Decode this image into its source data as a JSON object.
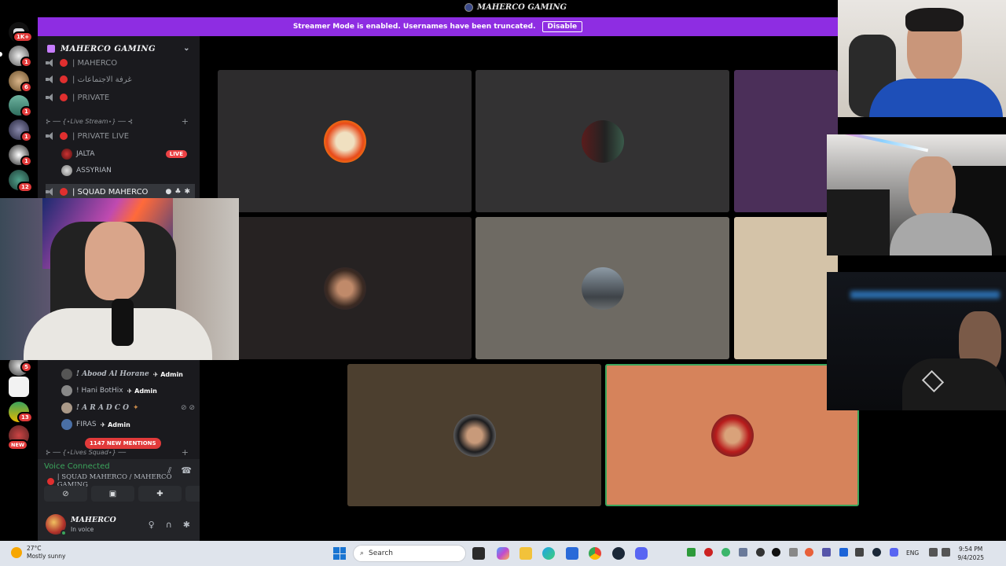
{
  "window": {
    "title": "MAHERCO GAMING"
  },
  "banner": {
    "text": "Streamer Mode is enabled. Usernames have been truncated.",
    "button": "Disable"
  },
  "rail": {
    "top_badge": "1K+",
    "badges": [
      "1",
      "6",
      "1",
      "1",
      "1",
      "12",
      "5",
      "13",
      "NEW"
    ]
  },
  "guild": {
    "name": "MAHERCO GAMING"
  },
  "channels": [
    {
      "label": "| MAHERCO"
    },
    {
      "label": "| غرفة الاجتماعات"
    },
    {
      "label": "| PRIVATE"
    }
  ],
  "category_live": "⊱ ── {⋆Live Stream⋆} ── ⊰",
  "channel_private_live": "| PRIVATE LIVE",
  "live_members": [
    {
      "name": "JALTA",
      "badge": "LIVE"
    },
    {
      "name": "ASSYRIAN"
    }
  ],
  "active_channel": "| SQUAD MAHERCO",
  "squad_members": [
    {
      "name": "! Abood Al Horane",
      "role": "Admin"
    },
    {
      "name": "! Hani BotHix",
      "role": "Admin"
    },
    {
      "name": "! A R A D C O",
      "role": ""
    },
    {
      "name": "FIRAS",
      "role": "Admin"
    }
  ],
  "mentions": "1147 NEW MENTIONS",
  "category_lives_squad": "⊱ ── {⋆Lives Squad⋆} ──",
  "voice": {
    "status": "Voice Connected",
    "channel": "| SQUAD MAHERCO / MAHERCO GAMING"
  },
  "user": {
    "name": "MAHERCO",
    "status": "In voice"
  },
  "taskbar": {
    "weather_temp": "27°C",
    "weather_desc": "Mostly sunny",
    "search_placeholder": "Search",
    "lang": "ENG",
    "time": "9:54 PM",
    "date": "9/4/2025"
  },
  "colors": {
    "accent": "#8e2de2",
    "danger": "#e02f2f",
    "online": "#3ba55c"
  }
}
